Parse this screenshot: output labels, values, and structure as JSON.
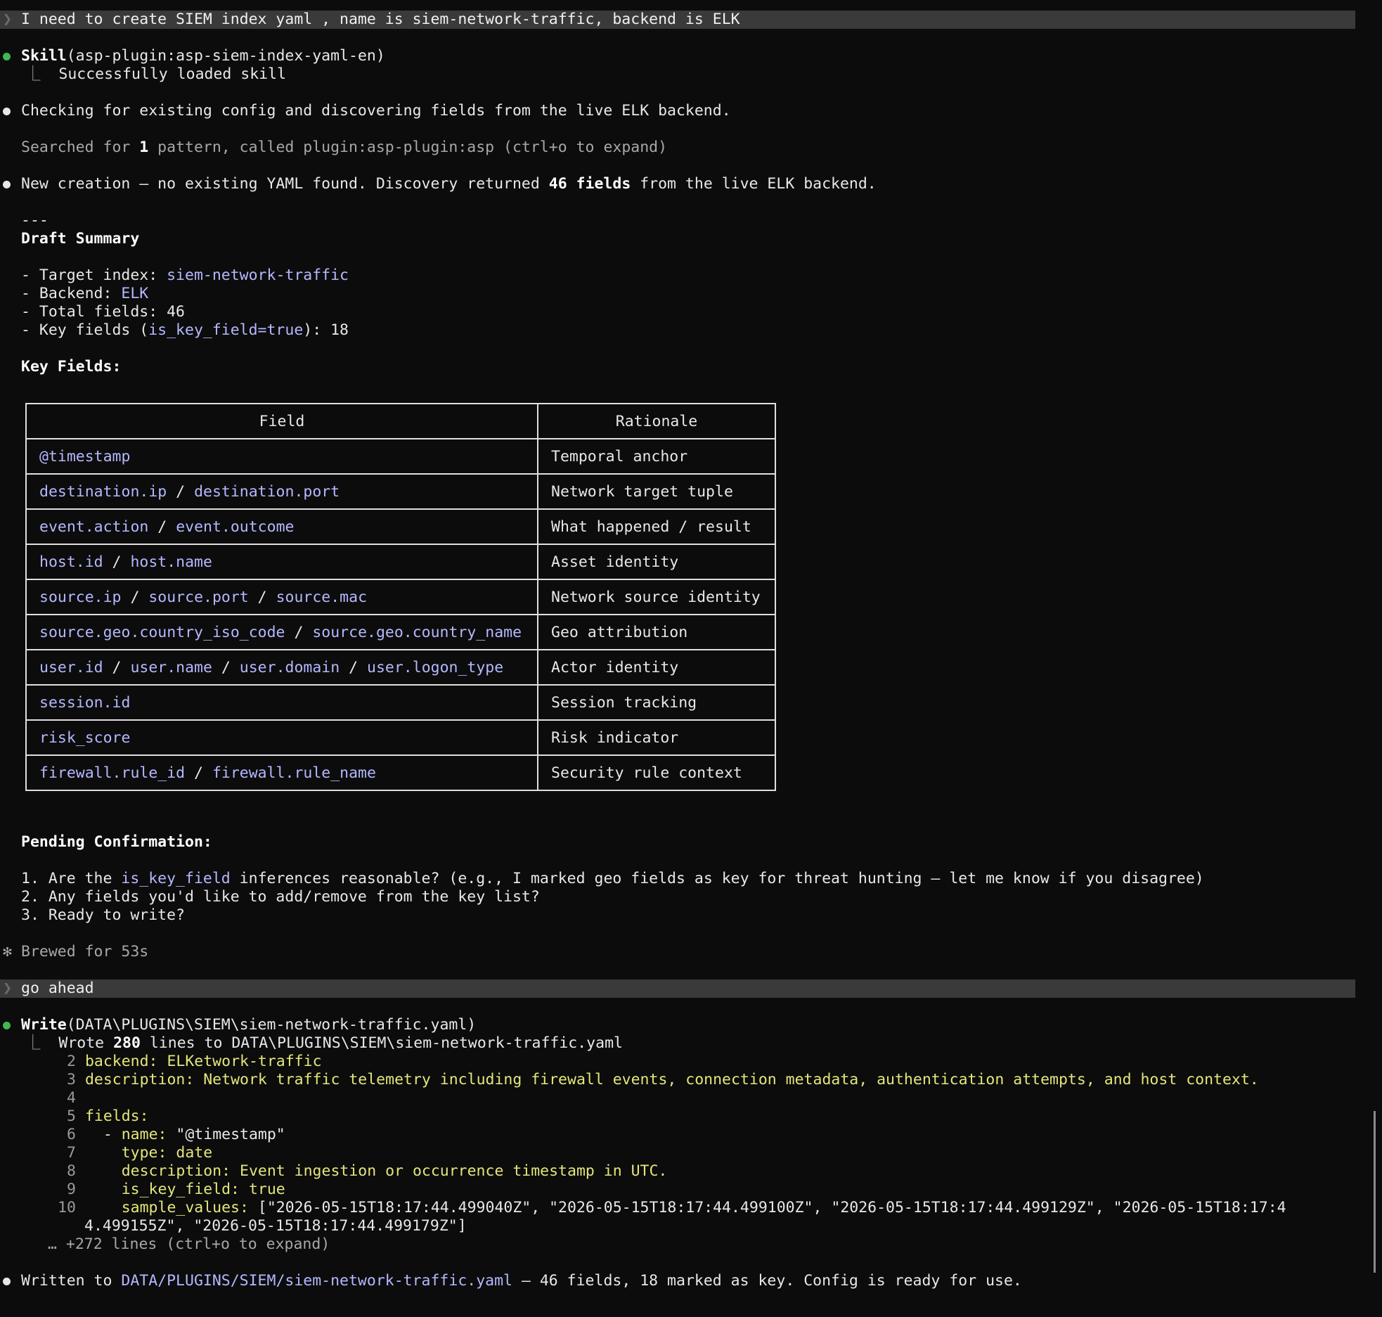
{
  "prompt1": "I need to create SIEM index yaml , name is siem-network-traffic, backend is ELK",
  "skill": {
    "tool": "Skill",
    "arg": "(asp-plugin:asp-siem-index-yaml-en)",
    "result": "Successfully loaded skill"
  },
  "checking": "Checking for existing config and discovering fields from the live ELK backend.",
  "searched": {
    "pre": "Searched for ",
    "count": "1",
    "post": " pattern, called plugin:asp-plugin:asp (ctrl+o to expand)"
  },
  "creation": {
    "pre": "New creation — no existing YAML found. Discovery returned ",
    "bold": "46 fields",
    "post": " from the live ELK backend."
  },
  "separator": "---",
  "draft": {
    "title": "Draft Summary",
    "target_label": "- Target index: ",
    "target_value": "siem-network-traffic",
    "backend_label": "- Backend: ",
    "backend_value": "ELK",
    "total": "- Total fields: 46",
    "key_pre": "- Key fields (",
    "key_code": "is_key_field=true",
    "key_post": "): 18"
  },
  "key_fields_title": "Key Fields:",
  "table": {
    "headers": [
      "Field",
      "Rationale"
    ],
    "rows": [
      {
        "fields": [
          "@timestamp"
        ],
        "rationale": "Temporal anchor"
      },
      {
        "fields": [
          "destination.ip",
          "destination.port"
        ],
        "rationale": "Network target tuple"
      },
      {
        "fields": [
          "event.action",
          "event.outcome"
        ],
        "rationale": "What happened / result"
      },
      {
        "fields": [
          "host.id",
          "host.name"
        ],
        "rationale": "Asset identity"
      },
      {
        "fields": [
          "source.ip",
          "source.port",
          "source.mac"
        ],
        "rationale": "Network source identity"
      },
      {
        "fields": [
          "source.geo.country_iso_code",
          "source.geo.country_name"
        ],
        "rationale": "Geo attribution"
      },
      {
        "fields": [
          "user.id",
          "user.name",
          "user.domain",
          "user.logon_type"
        ],
        "rationale": "Actor identity"
      },
      {
        "fields": [
          "session.id"
        ],
        "rationale": "Session tracking"
      },
      {
        "fields": [
          "risk_score"
        ],
        "rationale": "Risk indicator"
      },
      {
        "fields": [
          "firewall.rule_id",
          "firewall.rule_name"
        ],
        "rationale": "Security rule context"
      }
    ]
  },
  "pending": {
    "title": "Pending Confirmation:",
    "q1_pre": "1. Are the ",
    "q1_code": "is_key_field",
    "q1_post": " inferences reasonable? (e.g., I marked geo fields as key for threat hunting — let me know if you disagree)",
    "q2": "2. Any fields you'd like to add/remove from the key list?",
    "q3": "3. Ready to write?"
  },
  "brewed": {
    "icon": "✻",
    "text": "Brewed for 53s"
  },
  "prompt2": "go ahead",
  "write": {
    "tool": "Write",
    "arg": "(DATA\\PLUGINS\\SIEM\\siem-network-traffic.yaml)",
    "result_pre": "Wrote ",
    "result_count": "280",
    "result_post": " lines to DATA\\PLUGINS\\SIEM\\siem-network-traffic.yaml"
  },
  "code": {
    "l2": {
      "n": "2",
      "key": "backend:",
      "val": " ELKetwork-traffic"
    },
    "l3": {
      "n": "3",
      "key": "description:",
      "val": " Network traffic telemetry including firewall events, connection metadata, authentication attempts, and host context."
    },
    "l4": {
      "n": "4"
    },
    "l5": {
      "n": "5",
      "key": "fields:"
    },
    "l6": {
      "n": "6",
      "dash": "  - ",
      "key": "name:",
      "val": " \"@timestamp\""
    },
    "l7": {
      "n": "7",
      "key": "    type:",
      "val": " date"
    },
    "l8": {
      "n": "8",
      "key": "    description:",
      "val": " Event ingestion or occurrence timestamp in UTC."
    },
    "l9": {
      "n": "9",
      "key": "    is_key_field:",
      "val": " true"
    },
    "l10": {
      "n": "10",
      "key": "    sample_values:",
      "val": " [\"2026-05-15T18:17:44.499040Z\", \"2026-05-15T18:17:44.499100Z\", \"2026-05-15T18:17:44.499129Z\", \"2026-05-15T18:17:4"
    },
    "l10b": "4.499155Z\", \"2026-05-15T18:17:44.499179Z\"]",
    "more": "… +272 lines (ctrl+o to expand)"
  },
  "final": {
    "pre": "Written to ",
    "path": "DATA/PLUGINS/SIEM/siem-network-traffic.yaml",
    "post": " — 46 fields, 18 marked as key. Config is ready for use."
  }
}
